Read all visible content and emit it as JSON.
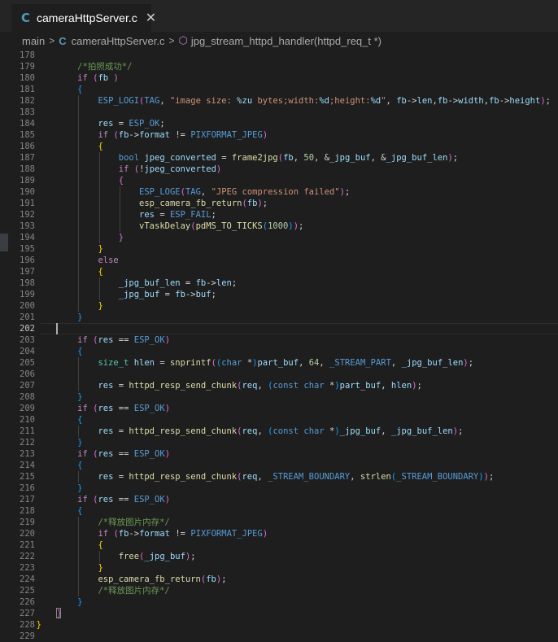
{
  "tabs": [
    {
      "icon": "c-file-icon",
      "label": "cameraHttpServer.c",
      "close": "✕"
    }
  ],
  "breadcrumb": {
    "folder": "main",
    "file": "cameraHttpServer.c",
    "symbol": "jpg_stream_httpd_handler(httpd_req_t *)"
  },
  "editor": {
    "current_line": 202,
    "lines": [
      {
        "n": 178,
        "t": ""
      },
      {
        "n": 179,
        "t": "        /*拍照成功*/"
      },
      {
        "n": 180,
        "t": "        if (fb )"
      },
      {
        "n": 181,
        "t": "        {"
      },
      {
        "n": 182,
        "t": "            ESP_LOGI(TAG, \"image size: %zu bytes;width:%d;height:%d\", fb->len,fb->width,fb->height);"
      },
      {
        "n": 183,
        "t": ""
      },
      {
        "n": 184,
        "t": "            res = ESP_OK;"
      },
      {
        "n": 185,
        "t": "            if (fb->format != PIXFORMAT_JPEG)"
      },
      {
        "n": 186,
        "t": "            {"
      },
      {
        "n": 187,
        "t": "                bool jpeg_converted = frame2jpg(fb, 50, &_jpg_buf, &_jpg_buf_len);"
      },
      {
        "n": 188,
        "t": "                if (!jpeg_converted)"
      },
      {
        "n": 189,
        "t": "                {"
      },
      {
        "n": 190,
        "t": "                    ESP_LOGE(TAG, \"JPEG compression failed\");"
      },
      {
        "n": 191,
        "t": "                    esp_camera_fb_return(fb);"
      },
      {
        "n": 192,
        "t": "                    res = ESP_FAIL;"
      },
      {
        "n": 193,
        "t": "                    vTaskDelay(pdMS_TO_TICKS(1000));"
      },
      {
        "n": 194,
        "t": "                }"
      },
      {
        "n": 195,
        "t": "            }"
      },
      {
        "n": 196,
        "t": "            else"
      },
      {
        "n": 197,
        "t": "            {"
      },
      {
        "n": 198,
        "t": "                _jpg_buf_len = fb->len;"
      },
      {
        "n": 199,
        "t": "                _jpg_buf = fb->buf;"
      },
      {
        "n": 200,
        "t": "            }"
      },
      {
        "n": 201,
        "t": "        }"
      },
      {
        "n": 202,
        "t": ""
      },
      {
        "n": 203,
        "t": "        if (res == ESP_OK)"
      },
      {
        "n": 204,
        "t": "        {"
      },
      {
        "n": 205,
        "t": "            size_t hlen = snprintf((char *)part_buf, 64, _STREAM_PART, _jpg_buf_len);"
      },
      {
        "n": 206,
        "t": ""
      },
      {
        "n": 207,
        "t": "            res = httpd_resp_send_chunk(req, (const char *)part_buf, hlen);"
      },
      {
        "n": 208,
        "t": "        }"
      },
      {
        "n": 209,
        "t": "        if (res == ESP_OK)"
      },
      {
        "n": 210,
        "t": "        {"
      },
      {
        "n": 211,
        "t": "            res = httpd_resp_send_chunk(req, (const char *)_jpg_buf, _jpg_buf_len);"
      },
      {
        "n": 212,
        "t": "        }"
      },
      {
        "n": 213,
        "t": "        if (res == ESP_OK)"
      },
      {
        "n": 214,
        "t": "        {"
      },
      {
        "n": 215,
        "t": "            res = httpd_resp_send_chunk(req, _STREAM_BOUNDARY, strlen(_STREAM_BOUNDARY));"
      },
      {
        "n": 216,
        "t": "        }"
      },
      {
        "n": 217,
        "t": "        if (res == ESP_OK)"
      },
      {
        "n": 218,
        "t": "        {"
      },
      {
        "n": 219,
        "t": "            /*释放图片内存*/"
      },
      {
        "n": 220,
        "t": "            if (fb->format != PIXFORMAT_JPEG)"
      },
      {
        "n": 221,
        "t": "            {"
      },
      {
        "n": 222,
        "t": "                free(_jpg_buf);"
      },
      {
        "n": 223,
        "t": "            }"
      },
      {
        "n": 224,
        "t": "            esp_camera_fb_return(fb);"
      },
      {
        "n": 225,
        "t": "            /*释放图片内存*/"
      },
      {
        "n": 226,
        "t": "        }"
      },
      {
        "n": 227,
        "t": "    }"
      },
      {
        "n": 228,
        "t": "}"
      },
      {
        "n": 229,
        "t": ""
      }
    ]
  },
  "colors": {
    "keyword": "#569cd6",
    "control": "#c586c0",
    "function": "#dcdcaa",
    "string": "#ce9178",
    "number": "#b5cea8",
    "variable": "#9cdcfe",
    "type": "#4ec9b0",
    "comment": "#6a9955"
  }
}
